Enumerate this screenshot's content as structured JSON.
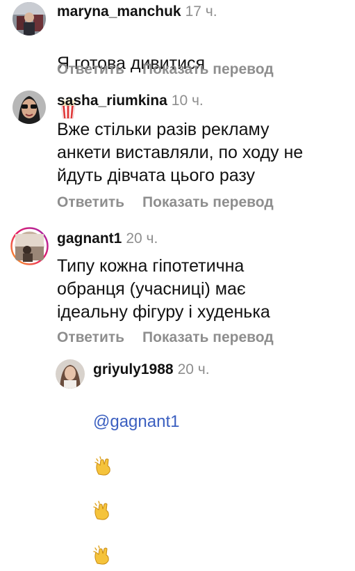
{
  "actions": {
    "reply_label": "Ответить",
    "translate_label": "Показать перевод"
  },
  "comments": [
    {
      "username": "maryna_manchuk",
      "time": "17 ч.",
      "text": "Я готова дивитися",
      "emoji": "popcorn"
    },
    {
      "username": "sasha_riumkina",
      "time": "10 ч.",
      "text": "Вже стільки разів рекламу\nанкети виставляли, по ходу не\nйдуть дівчата цього разу"
    },
    {
      "username": "gagnant1",
      "time": "20 ч.",
      "text": "Типу кожна гіпотетична\nобранця (учасниці)  має\nідеальну фігуру і худенька"
    }
  ],
  "reply": {
    "username": "griyuly1988",
    "time": "20 ч.",
    "mention": "@gagnant1",
    "emoji": [
      "clapping-hands",
      "clapping-hands",
      "clapping-hands"
    ]
  }
}
